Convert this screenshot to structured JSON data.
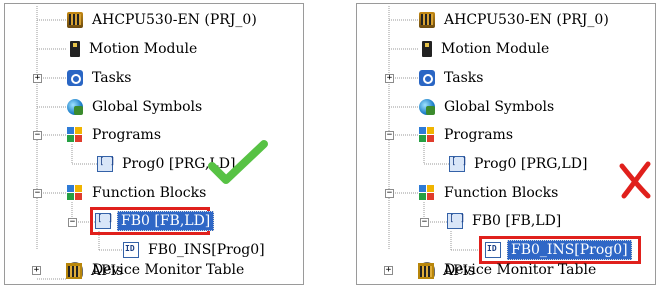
{
  "panels": {
    "left": {
      "items": [
        {
          "label": "AHCPU530-EN  (PRJ_0)",
          "icon": "cpu-icon"
        },
        {
          "label": "Motion Module",
          "icon": "motion-module-icon"
        },
        {
          "label": "Tasks",
          "icon": "tasks-icon",
          "expander": "+"
        },
        {
          "label": "Global Symbols",
          "icon": "global-symbols-icon"
        },
        {
          "label": "Programs",
          "icon": "folder-icon",
          "expander": "−"
        },
        {
          "label": "Prog0 [PRG,LD]",
          "icon": "pou-icon"
        },
        {
          "label": "Function Blocks",
          "icon": "folder-icon",
          "expander": "−"
        },
        {
          "label": "FB0 [FB,LD]",
          "icon": "pou-icon",
          "expander": "−",
          "selected": true
        },
        {
          "label": "FB0_INS[Prog0]",
          "icon": "instance-icon"
        },
        {
          "label": "Device Monitor Table",
          "icon": "monitor-icon"
        },
        {
          "label": "APIs",
          "icon": "apis-icon",
          "expander": "+"
        }
      ],
      "mark": "check-mark-icon"
    },
    "right": {
      "items": [
        {
          "label": "AHCPU530-EN  (PRJ_0)",
          "icon": "cpu-icon"
        },
        {
          "label": "Motion Module",
          "icon": "motion-module-icon"
        },
        {
          "label": "Tasks",
          "icon": "tasks-icon",
          "expander": "+"
        },
        {
          "label": "Global Symbols",
          "icon": "global-symbols-icon"
        },
        {
          "label": "Programs",
          "icon": "folder-icon",
          "expander": "−"
        },
        {
          "label": "Prog0 [PRG,LD]",
          "icon": "pou-icon"
        },
        {
          "label": "Function Blocks",
          "icon": "folder-icon",
          "expander": "−"
        },
        {
          "label": "FB0 [FB,LD]",
          "icon": "pou-icon",
          "expander": "−"
        },
        {
          "label": "FB0_INS[Prog0]",
          "icon": "instance-icon",
          "selected": true
        },
        {
          "label": "Device Monitor Table",
          "icon": "monitor-icon"
        },
        {
          "label": "APIs",
          "icon": "apis-icon",
          "expander": "+"
        }
      ],
      "mark": "cross-mark-icon"
    }
  },
  "colors": {
    "selection": "#2f67c6",
    "highlight_box": "#e0201c",
    "check": "#57c244",
    "cross": "#e0201c"
  }
}
